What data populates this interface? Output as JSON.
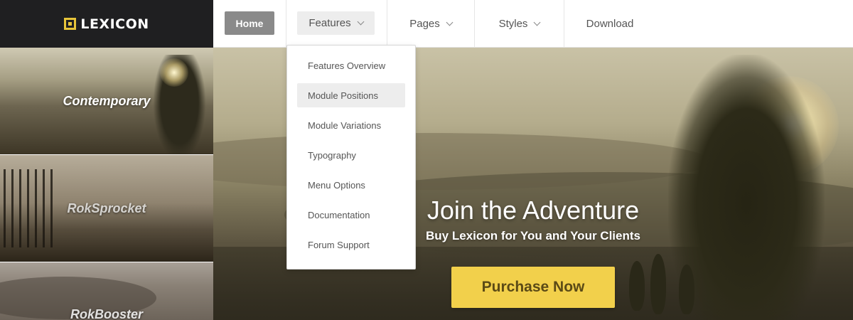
{
  "logo": {
    "text": "LEXICON",
    "accent": "#e8c53a"
  },
  "nav": {
    "home": "Home",
    "features": "Features",
    "pages": "Pages",
    "styles": "Styles",
    "download": "Download"
  },
  "features_menu": {
    "items": [
      "Features Overview",
      "Module Positions",
      "Module Variations",
      "Typography",
      "Menu Options",
      "Documentation",
      "Forum Support"
    ],
    "highlighted": "Module Positions"
  },
  "thumbnails": [
    "Contemporary",
    "RokSprocket",
    "RokBooster"
  ],
  "hero": {
    "title": "Join the Adventure",
    "subtitle": "Buy Lexicon for You and Your Clients",
    "cta": "Purchase Now",
    "cta_color": "#f2d04b"
  }
}
